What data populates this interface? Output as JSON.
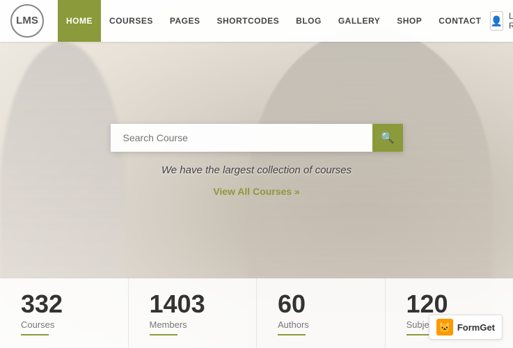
{
  "logo": {
    "text": "LMS",
    "tagline": ""
  },
  "nav": {
    "links": [
      {
        "label": "HOME",
        "active": true
      },
      {
        "label": "COURSES",
        "active": false
      },
      {
        "label": "PAGES",
        "active": false
      },
      {
        "label": "SHORTCODES",
        "active": false
      },
      {
        "label": "BLOG",
        "active": false
      },
      {
        "label": "GALLERY",
        "active": false
      },
      {
        "label": "SHOP",
        "active": false
      },
      {
        "label": "CONTACT",
        "active": false
      }
    ],
    "login_label": "Login",
    "register_label": "Register"
  },
  "hero": {
    "search_placeholder": "Search Course",
    "subtitle": "We have the largest collection of courses",
    "view_all_label": "View All Courses"
  },
  "stats": [
    {
      "number": "332",
      "label": "Courses"
    },
    {
      "number": "1403",
      "label": "Members"
    },
    {
      "number": "60",
      "label": "Authors"
    },
    {
      "number": "120",
      "label": "Subjects"
    }
  ],
  "formget": {
    "label": "FormGet"
  },
  "colors": {
    "accent": "#8b9a3a",
    "text_dark": "#333",
    "text_mid": "#777"
  }
}
